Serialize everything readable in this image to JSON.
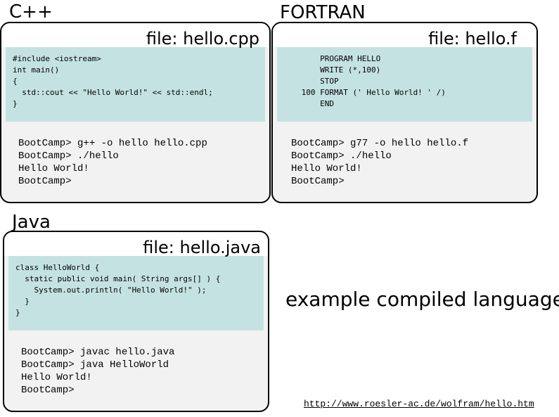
{
  "cpp": {
    "language": "C++",
    "file_label": "file: hello.cpp",
    "code": "#include <iostream>\nint main()\n{\n  std::cout << \"Hello World!\" << std::endl;\n}",
    "terminal": "BootCamp> g++ -o hello hello.cpp\nBootCamp> ./hello\nHello World!\nBootCamp>"
  },
  "fortran": {
    "language": "FORTRAN",
    "file_label": "file: hello.f",
    "code": "     PROGRAM HELLO\n     WRITE (*,100)\n     STOP\n 100 FORMAT (' Hello World! ' /)\n     END",
    "terminal": "BootCamp> g77 -o hello hello.f\nBootCamp> ./hello\nHello World!\nBootCamp>"
  },
  "java": {
    "language": "Java",
    "file_label": "file: hello.java",
    "code": "class HelloWorld {\n  static public void main( String args[] ) {\n    System.out.println( \"Hello World!\" );\n  }\n}",
    "terminal": "BootCamp> javac hello.java\nBootCamp> java HelloWorld\nHello World!\nBootCamp>"
  },
  "caption": "example compiled languages",
  "source_url": "http://www.roesler-ac.de/wolfram/hello.htm"
}
